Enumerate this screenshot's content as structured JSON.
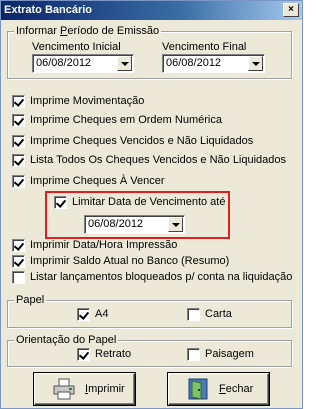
{
  "window": {
    "title": "Extrato Bancário",
    "close_glyph": "×"
  },
  "periodo": {
    "legend_pre": "Informar ",
    "legend_u": "P",
    "legend_post": "eríodo de Emissão",
    "inicial_label": "Vencimento Inicial",
    "inicial_value": "06/08/2012",
    "final_label": "Vencimento Final",
    "final_value": "06/08/2012"
  },
  "options": [
    {
      "label": "Imprime Movimentação",
      "checked": true
    },
    {
      "label": "Imprime Cheques em Ordem Numérica",
      "checked": true
    },
    {
      "label": "Imprime Cheques Vencidos e Não Liquidados",
      "checked": true
    },
    {
      "label": "Lista Todos Os Cheques Vencidos e Não Liquidados",
      "checked": true
    },
    {
      "label": "Imprime Cheques À Vencer",
      "checked": true
    }
  ],
  "limitar": {
    "label": "Limitar Data de Vencimento até",
    "checked": true,
    "date": "06/08/2012"
  },
  "options2": [
    {
      "label": "Imprimir Data/Hora Impressão",
      "checked": true
    },
    {
      "label": "Imprimir Saldo Atual no Banco (Resumo)",
      "checked": true
    },
    {
      "label": "Listar lançamentos bloqueados p/ conta na liquidação",
      "checked": false
    }
  ],
  "papel": {
    "legend": "Papel",
    "a4_label": "A4",
    "a4_checked": true,
    "carta_label": "Carta",
    "carta_checked": false
  },
  "orientacao": {
    "legend": "Orientação do Papel",
    "retrato_label": "Retrato",
    "retrato_checked": true,
    "paisagem_label": "Paisagem",
    "paisagem_checked": false
  },
  "buttons": {
    "imprimir_u": "I",
    "imprimir_rest": "mprimir",
    "fechar_u": "F",
    "fechar_rest": "echar"
  },
  "icons": {
    "imprimir": "printer-icon",
    "fechar": "exit-door-icon"
  }
}
